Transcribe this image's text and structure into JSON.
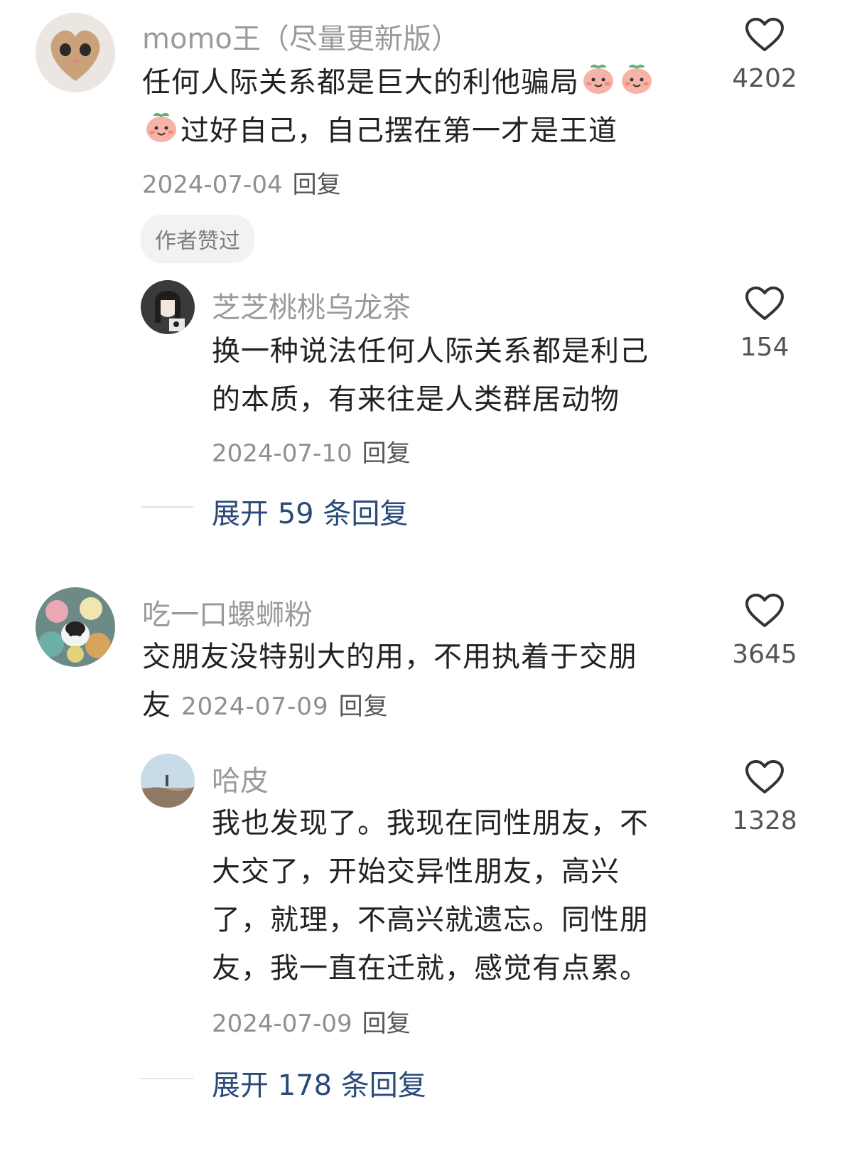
{
  "comments": [
    {
      "user": "momo王（尽量更新版）",
      "text_line1": "任何人际关系都是巨大的利他骗局",
      "text_line2": "过好自己，自己摆在第一才是王道",
      "date": "2024-07-04",
      "reply_label": "回复",
      "likes": "4202",
      "badge": "作者赞过",
      "avatar_icon": "cat-avatar",
      "emoji_icon": "peach-face-emoji",
      "replies": [
        {
          "user": "芝芝桃桃乌龙茶",
          "text_line1": "换一种说法任何人际关系都是利己",
          "text_line2": "的本质，有来往是人类群居动物",
          "date": "2024-07-10",
          "reply_label": "回复",
          "likes": "154"
        }
      ],
      "expand_label": "展开 59 条回复"
    },
    {
      "user": "吃一口螺蛳粉",
      "text_line1": "交朋友没特别大的用，不用执着于交朋",
      "text_line2": "友",
      "date": "2024-07-09",
      "reply_label": "回复",
      "likes": "3645",
      "replies": [
        {
          "user": "哈皮",
          "text_lines": [
            "我也发现了。我现在同性朋友，不",
            "大交了，开始交异性朋友，高兴",
            "了，就理，不高兴就遗忘。同性朋",
            "友，我一直在迁就，感觉有点累。"
          ],
          "date": "2024-07-09",
          "reply_label": "回复",
          "likes": "1328"
        }
      ],
      "expand_label": "展开 178 条回复"
    }
  ],
  "colors": {
    "link": "#2a4a7a",
    "muted": "#9a9a9a",
    "badge_bg": "#f2f2f2"
  }
}
